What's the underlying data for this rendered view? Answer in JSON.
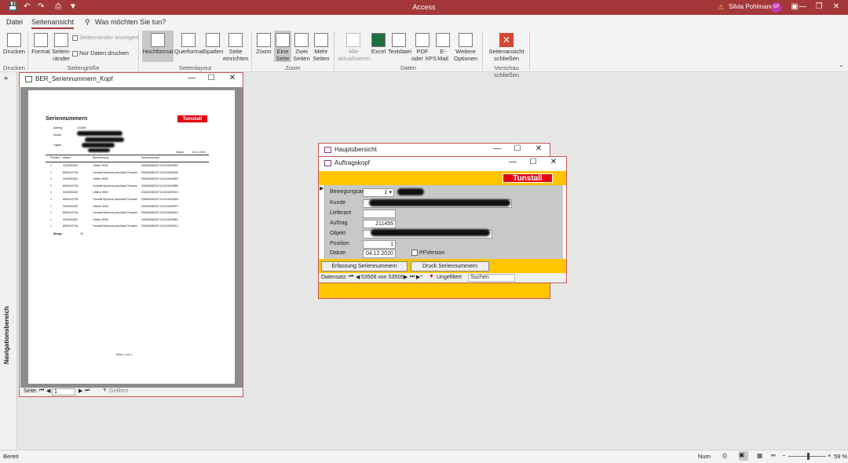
{
  "titlebar": {
    "app_title": "Access",
    "user_name": "Silvia Pohlmann",
    "avatar_initials": "SP"
  },
  "menu": {
    "file": "Datei",
    "print_preview": "Seitenansicht",
    "tell_me": "Was möchten Sie tun?"
  },
  "ribbon": {
    "print": "Drucken",
    "format": "Format",
    "margins": "Seiten-\nränder",
    "show_margins": "Seitenränder anzeigen",
    "data_only": "Nur Daten drucken",
    "portrait": "Hochformat",
    "landscape": "Querformat",
    "columns": "Spalten",
    "page_setup": "Seite\neinrichten",
    "zoom": "Zoom",
    "one_page": "Eine\nSeite",
    "two_pages": "Zwei\nSeiten",
    "more_pages": "Mehr\nSeiten",
    "refresh_all": "Alle\naktualisieren",
    "excel": "Excel",
    "text_file": "Textdatei",
    "pdf": "PDF\noder XPS",
    "email": "E-\nMail",
    "more_options": "Weitere\nOptionen",
    "close_preview": "Seitenansicht\nschließen",
    "groups": {
      "print": "Drucken",
      "page_size": "Seitengröße",
      "page_layout": "Seitenlayout",
      "zoom": "Zoom",
      "data": "Daten",
      "close": "Vorschau schließen"
    }
  },
  "nav_pane": {
    "label": "Navigationsbereich"
  },
  "report_window": {
    "title": "BER_Seriennummern_Kopf",
    "page_label": "Seite:",
    "page_number": "1",
    "filter": "Gefiltert",
    "report": {
      "heading": "Seriennummern",
      "logo": "Tunstall",
      "auftrag_label": "Auftrag",
      "auftrag_value": "211455",
      "kunde_label": "Kunde",
      "objekt_label": "Objekt",
      "datum_label": "Datum",
      "datum_value": "04.12.2020",
      "columns": [
        "Position",
        "Artikel",
        "Bezeichnung",
        "Seriennummer"
      ],
      "rows": [
        [
          "1",
          "0400900822",
          "Lifeline 5000",
          "0060600823471412034099E0"
        ],
        [
          "1",
          "8960100794",
          "Tunstall Mydome peachtalk Pendant",
          "0060600823471412034099A0"
        ],
        [
          "1",
          "0400900822",
          "Lifeline 5000",
          "0060600823471412034099E0"
        ],
        [
          "1",
          "8960100794",
          "Tunstall Mydome peachtalk Pendant",
          "0060600823471412034099B0"
        ],
        [
          "1",
          "0400900822",
          "Lifeline 5000",
          "0060600823471412034099C0"
        ],
        [
          "1",
          "8960100794",
          "Tunstall Mydome peachtalk Pendant",
          "0060600823471412034099D0"
        ],
        [
          "1",
          "0400900822",
          "Lifeline 5000",
          "0060600823471412034099F0"
        ],
        [
          "1",
          "8960100794",
          "Tunstall Mydome peachtalk Pendant",
          "0060600823471412034099A1"
        ],
        [
          "1",
          "0400900822",
          "Lifeline 5000",
          "0060600823471412034099B1"
        ],
        [
          "1",
          "8960100794",
          "Tunstall Mydome peachtalk Pendant",
          "0060600823471412034099C1"
        ]
      ],
      "total_label": "Menge",
      "total_value": "10",
      "footer": "Seite 1 von 1"
    }
  },
  "main_window": {
    "title": "Hauptübersicht"
  },
  "form_window": {
    "title": "Auftragskopf",
    "logo": "Tunstall",
    "fields": {
      "bewegungsart_label": "Bewegungsart",
      "bewegungsart_value": "1",
      "kunde_label": "Kunde",
      "lieferant_label": "Lieferant",
      "auftrag_label": "Auftrag",
      "auftrag_value": "211455",
      "objekt_label": "Objekt",
      "position_label": "Position",
      "position_value": "1",
      "datum_label": "Datum",
      "datum_value": "04.12.2020",
      "pfversion_label": "PFVersion"
    },
    "buttons": {
      "erfassung": "Erfassung Seriennummern",
      "druck": "Druck Seriennummern"
    },
    "record_nav": {
      "label": "Datensatz:",
      "position": "53506 von 53506",
      "filter": "Ungefiltert",
      "search": "Suchen"
    }
  },
  "statusbar": {
    "left": "Bereit",
    "num": "Num",
    "zoom": "59 %"
  }
}
